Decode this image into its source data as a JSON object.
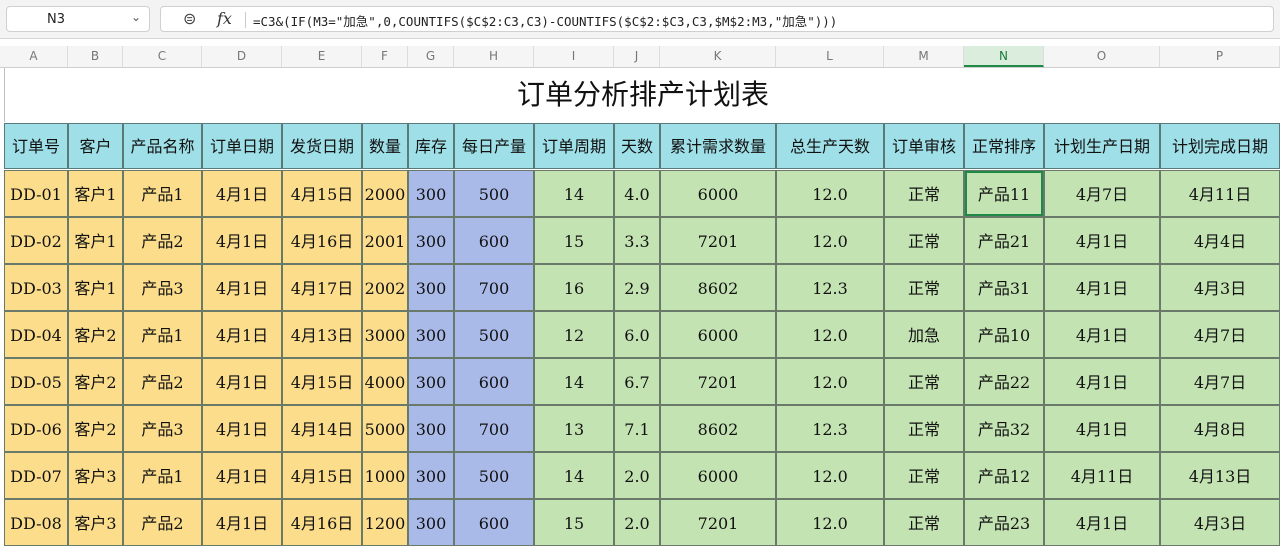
{
  "formula_bar": {
    "cell_ref": "N3",
    "formula": "=C3&(IF(M3=\"加急\",0,COUNTIFS($C$2:C3,C3)-COUNTIFS($C$2:$C3,C3,$M$2:M3,\"加急\")))"
  },
  "column_letters": [
    "A",
    "B",
    "C",
    "D",
    "E",
    "F",
    "G",
    "H",
    "I",
    "J",
    "K",
    "L",
    "M",
    "N",
    "O",
    "P"
  ],
  "sheet": {
    "title": "订单分析排产计划表",
    "headers": [
      "订单号",
      "客户",
      "产品名称",
      "订单日期",
      "发货日期",
      "数量",
      "库存",
      "每日产量",
      "订单周期",
      "天数",
      "累计需求数量",
      "总生产天数",
      "订单审核",
      "正常排序",
      "计划生产日期",
      "计划完成日期"
    ],
    "rows": [
      [
        "DD-01",
        "客户1",
        "产品1",
        "4月1日",
        "4月15日",
        "2000",
        "300",
        "500",
        "14",
        "4.0",
        "6000",
        "12.0",
        "正常",
        "产品11",
        "4月7日",
        "4月11日"
      ],
      [
        "DD-02",
        "客户1",
        "产品2",
        "4月1日",
        "4月16日",
        "2001",
        "300",
        "600",
        "15",
        "3.3",
        "7201",
        "12.0",
        "正常",
        "产品21",
        "4月1日",
        "4月4日"
      ],
      [
        "DD-03",
        "客户1",
        "产品3",
        "4月1日",
        "4月17日",
        "2002",
        "300",
        "700",
        "16",
        "2.9",
        "8602",
        "12.3",
        "正常",
        "产品31",
        "4月1日",
        "4月3日"
      ],
      [
        "DD-04",
        "客户2",
        "产品1",
        "4月1日",
        "4月13日",
        "3000",
        "300",
        "500",
        "12",
        "6.0",
        "6000",
        "12.0",
        "加急",
        "产品10",
        "4月1日",
        "4月7日"
      ],
      [
        "DD-05",
        "客户2",
        "产品2",
        "4月1日",
        "4月15日",
        "4000",
        "300",
        "600",
        "14",
        "6.7",
        "7201",
        "12.0",
        "正常",
        "产品22",
        "4月1日",
        "4月7日"
      ],
      [
        "DD-06",
        "客户2",
        "产品3",
        "4月1日",
        "4月14日",
        "5000",
        "300",
        "700",
        "13",
        "7.1",
        "8602",
        "12.3",
        "正常",
        "产品32",
        "4月1日",
        "4月8日"
      ],
      [
        "DD-07",
        "客户3",
        "产品1",
        "4月1日",
        "4月15日",
        "1000",
        "300",
        "500",
        "14",
        "2.0",
        "6000",
        "12.0",
        "正常",
        "产品12",
        "4月11日",
        "4月13日"
      ],
      [
        "DD-08",
        "客户3",
        "产品2",
        "4月1日",
        "4月16日",
        "1200",
        "300",
        "600",
        "15",
        "2.0",
        "7201",
        "12.0",
        "正常",
        "产品23",
        "4月1日",
        "4月3日"
      ]
    ]
  }
}
